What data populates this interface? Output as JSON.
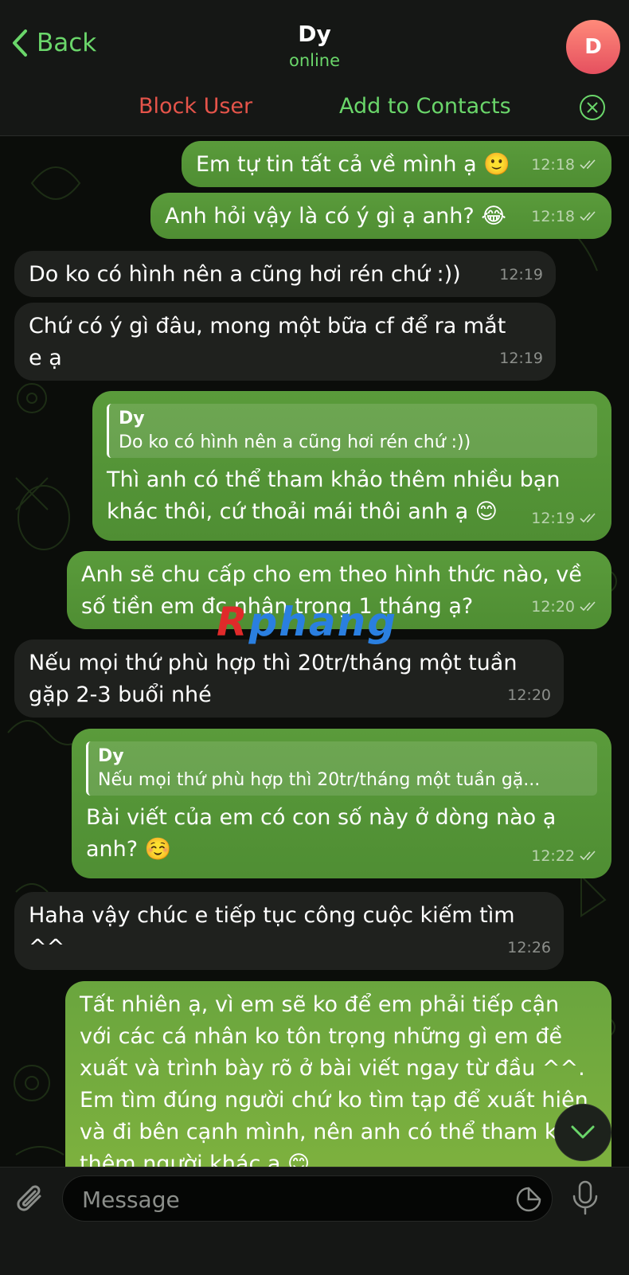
{
  "header": {
    "back_label": "Back",
    "title": "Dy",
    "status": "online",
    "avatar_initial": "D"
  },
  "actions": {
    "block": "Block User",
    "add": "Add to Contacts"
  },
  "watermark": {
    "part1": "R",
    "part2": "phang"
  },
  "messages": [
    {
      "dir": "out",
      "text": "Em tự tin tất cả về mình ạ 🙂",
      "time": "12:18",
      "read": true
    },
    {
      "dir": "out",
      "text": "Anh hỏi vậy là có ý gì ạ anh? 😂",
      "time": "12:18",
      "read": true
    },
    {
      "dir": "in",
      "text": "Do ko có hình nên a cũng hơi rén chứ :))",
      "time": "12:19"
    },
    {
      "dir": "in",
      "text": "Chứ có ý gì đâu, mong một bữa cf để ra mắt e ạ",
      "time": "12:19"
    },
    {
      "dir": "out",
      "quote_name": "Dy",
      "quote_text": "Do ko có hình nên a cũng hơi rén chứ :))",
      "text": "Thì anh có thể tham khảo thêm nhiều bạn khác thôi, cứ thoải mái thôi anh ạ 😊",
      "time": "12:19",
      "read": true
    },
    {
      "dir": "out",
      "text": "Anh sẽ chu cấp cho em theo hình thức nào, về số tiền em đc nhận trong 1 tháng ạ?",
      "time": "12:20",
      "read": true
    },
    {
      "dir": "in",
      "text": "Nếu mọi thứ phù hợp thì 20tr/tháng một tuần gặp 2-3 buổi nhé",
      "time": "12:20"
    },
    {
      "dir": "out",
      "quote_name": "Dy",
      "quote_text": "Nếu mọi thứ phù hợp thì 20tr/tháng một tuần gặ...",
      "text": "Bài viết của em có con số này ở dòng nào ạ anh? ☺️",
      "time": "12:22",
      "read": true
    },
    {
      "dir": "in",
      "text": "Haha vậy chúc e tiếp tục công cuộc kiếm tìm ^^",
      "time": "12:26"
    },
    {
      "dir": "out",
      "text": "Tất nhiên ạ, vì em sẽ ko để em phải tiếp cận với các cá nhân ko tôn trọng những gì em đề xuất và trình bày rõ ở bài viết ngay từ đầu ^^. Em tìm đúng người chứ ko tìm tạp để xuất hiện và đi bên cạnh mình, nên anh có thể tham khảo thêm người khác ạ 😊"
    }
  ],
  "input": {
    "placeholder": "Message"
  }
}
